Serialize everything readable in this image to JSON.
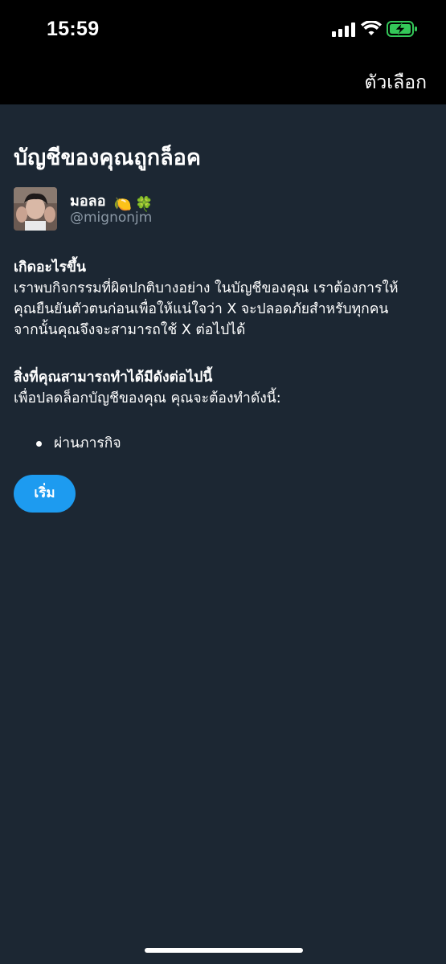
{
  "status_bar": {
    "time": "15:59",
    "icons": [
      "cellular-signal-icon",
      "wifi-icon",
      "battery-charging-icon"
    ]
  },
  "top_bar": {
    "options_label": "ตัวเลือก"
  },
  "page": {
    "title": "บัญชีของคุณถูกล็อค",
    "user": {
      "display_name": "มอลอ",
      "emojis": [
        "🍋",
        "🍀"
      ],
      "handle": "@mignonjm"
    },
    "what_happened": {
      "heading": "เกิดอะไรขึ้น",
      "lines": [
        "เราพบกิจกรรมที่ผิดปกติบางอย่าง ในบัญชีของคุณ เราต้องการให้",
        "คุณยืนยันตัวตนก่อนเพื่อให้แน่ใจว่า X จะปลอดภัยสำหรับทุกคน",
        "จากนั้นคุณจึงจะสามารถใช้ X ต่อไปได้"
      ]
    },
    "what_you_can_do": {
      "heading": "สิ่งที่คุณสามารถทำได้มีดังต่อไปนี้",
      "intro": "เพื่อปลดล็อกบัญชีของคุณ คุณจะต้องทำดังนี้:",
      "steps": [
        "ผ่านภารกิจ"
      ]
    },
    "start_button_label": "เริ่ม"
  },
  "colors": {
    "background": "#1c2733",
    "status_bar": "#000000",
    "accent": "#1d9bf0",
    "secondary_text": "#8b98a5",
    "battery_fill": "#34c759"
  }
}
